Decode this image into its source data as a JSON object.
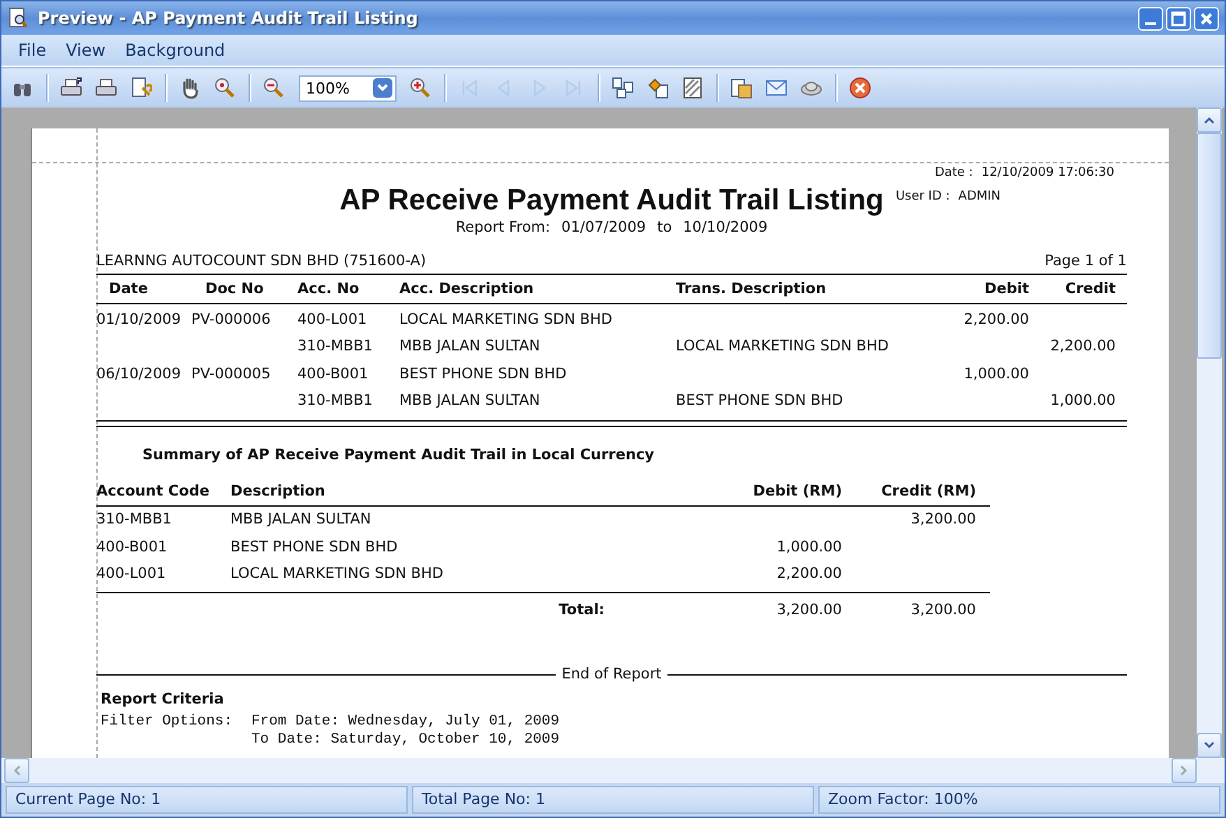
{
  "window": {
    "title": "Preview - AP Payment Audit Trail Listing"
  },
  "menu": [
    {
      "label": "File"
    },
    {
      "label": "View"
    },
    {
      "label": "Background"
    }
  ],
  "zoom": {
    "value": "100%"
  },
  "nav_buttons": [
    {
      "kind": "first",
      "disabled": true
    },
    {
      "kind": "prev",
      "disabled": true
    },
    {
      "kind": "next",
      "disabled": true
    },
    {
      "kind": "last",
      "disabled": true
    }
  ],
  "report": {
    "date_label": "Date :",
    "date": "12/10/2009 17:06:30",
    "user_label": "User ID :",
    "user": "ADMIN",
    "title": "AP Receive Payment  Audit Trail Listing",
    "range_label": "Report From:",
    "from": "01/07/2009",
    "to_label": "to",
    "to": "10/10/2009",
    "company": "LEARNNG AUTOCOUNT SDN BHD (751600-A)",
    "page": "Page 1 of 1",
    "columns": [
      "Date",
      "Doc No",
      "Acc. No",
      "Acc. Description",
      "Trans. Description",
      "Debit",
      "Credit"
    ],
    "rows": [
      [
        "01/10/2009",
        "PV-000006",
        "400-L001",
        "LOCAL MARKETING SDN BHD",
        "",
        "2,200.00",
        ""
      ],
      [
        "",
        "",
        "310-MBB1",
        "MBB JALAN SULTAN",
        "LOCAL MARKETING SDN BHD",
        "",
        "2,200.00"
      ],
      [
        "06/10/2009",
        "PV-000005",
        "400-B001",
        "BEST PHONE SDN BHD",
        "",
        "1,000.00",
        ""
      ],
      [
        "",
        "",
        "310-MBB1",
        "MBB JALAN SULTAN",
        "BEST PHONE SDN BHD",
        "",
        "1,000.00"
      ]
    ],
    "summary_title": "Summary of AP Receive Payment Audit Trail in Local Currency",
    "summary_columns": [
      "Account Code",
      "Description",
      "Debit (RM)",
      "Credit (RM)"
    ],
    "summary_rows": [
      [
        "310-MBB1",
        "MBB JALAN SULTAN",
        "",
        "3,200.00"
      ],
      [
        "400-B001",
        "BEST PHONE SDN BHD",
        "1,000.00",
        ""
      ],
      [
        "400-L001",
        "LOCAL MARKETING SDN BHD",
        "2,200.00",
        ""
      ]
    ],
    "total_label": "Total:",
    "total_debit": "3,200.00",
    "total_credit": "3,200.00",
    "end": "End of Report",
    "criteria_title": "Report Criteria",
    "criteria": [
      {
        "label": "Filter Options:",
        "text": "From Date: Wednesday, July 01, 2009"
      },
      {
        "text": "To Date: Saturday, October 10, 2009"
      }
    ]
  },
  "status_bar": [
    "Current Page No: 1",
    "Total Page No: 1",
    "Zoom Factor: 100%"
  ]
}
